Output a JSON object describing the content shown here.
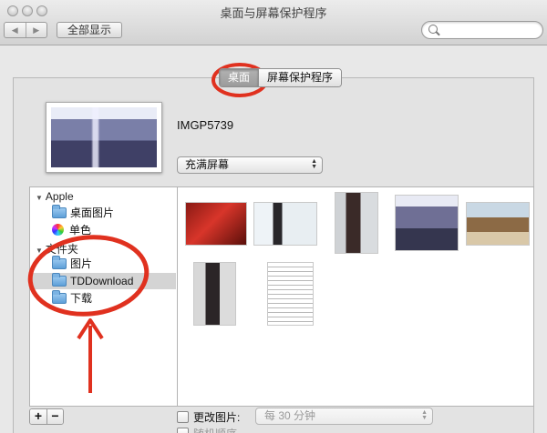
{
  "window": {
    "title": "桌面与屏幕保护程序"
  },
  "toolbar": {
    "back": "◀",
    "forward": "▶",
    "show_all": "全部显示",
    "search_placeholder": ""
  },
  "tabs": [
    {
      "label": "桌面",
      "active": true
    },
    {
      "label": "屏幕保护程序",
      "active": false
    }
  ],
  "preview": {
    "filename": "IMGP5739",
    "fill_mode": "充满屏幕"
  },
  "sidebar": {
    "apple_header": "Apple",
    "apple_items": [
      {
        "label": "桌面图片",
        "icon": "folder-icon"
      },
      {
        "label": "单色",
        "icon": "color-wheel-icon"
      }
    ],
    "folders_header": "文件夹",
    "folder_items": [
      {
        "label": "图片",
        "icon": "folder-icon",
        "selected": false
      },
      {
        "label": "TDDownload",
        "icon": "folder-icon",
        "selected": true
      },
      {
        "label": "下载",
        "icon": "folder-icon",
        "selected": false
      }
    ]
  },
  "bottom": {
    "add": "+",
    "remove": "−",
    "change_picture_label": "更改图片:",
    "interval": "每 30 分钟",
    "random_order_label": "随机顺序"
  },
  "colors": {
    "annotation": "#e0311f",
    "selection": "#d4d4d4"
  }
}
